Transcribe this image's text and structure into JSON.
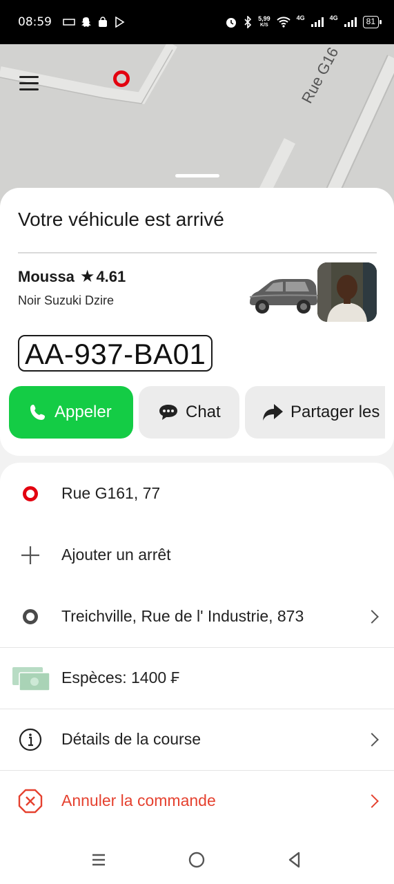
{
  "status_bar": {
    "time": "08:59",
    "net_speed": "5,99",
    "net_speed_unit": "K/S",
    "network_1": "4G",
    "network_2": "4G",
    "battery": "81"
  },
  "map": {
    "street_label": "Rue G16"
  },
  "ride": {
    "title": "Votre véhicule est arrivé",
    "driver_name": "Moussa",
    "rating": "4.61",
    "car_description": "Noir Suzuki Dzire",
    "plate": "AA-937-BA01"
  },
  "actions": {
    "call_label": "Appeler",
    "chat_label": "Chat",
    "share_label": "Partager les"
  },
  "route": {
    "pickup": "Rue G161, 77",
    "add_stop": "Ajouter un arrêt",
    "destination": "Treichville, Rue de l' Industrie, 873",
    "payment": "Espèces: 1400 ₣",
    "details": "Détails de la course",
    "cancel": "Annuler la commande"
  },
  "colors": {
    "accent_green": "#14cc45",
    "pickup_red": "#e3000f",
    "cancel_red": "#e5412f"
  }
}
